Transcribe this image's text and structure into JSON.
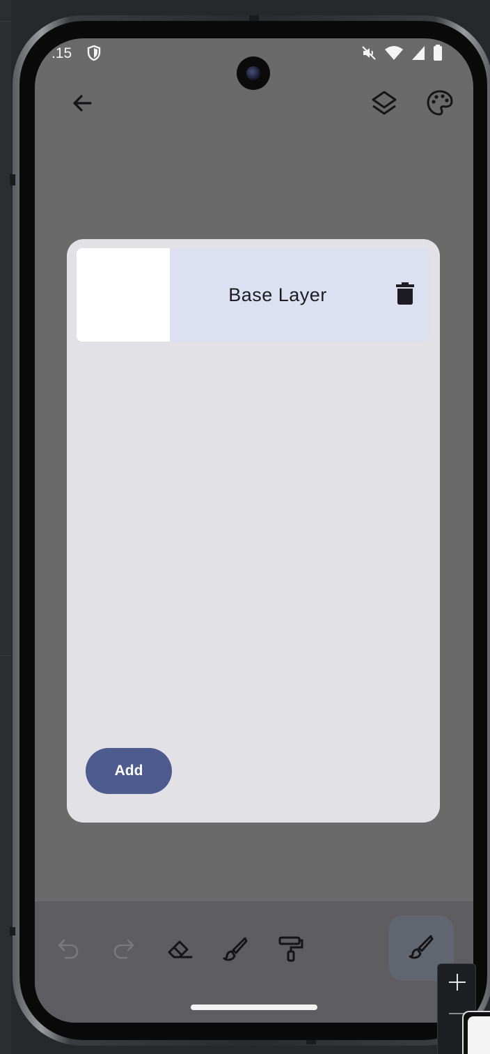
{
  "status_bar": {
    "time": ".15",
    "icons": [
      "shield-icon",
      "mute-icon",
      "wifi-icon",
      "signal-icon",
      "battery-icon"
    ]
  },
  "app_bar": {
    "back_icon": "arrow-back-icon",
    "layers_icon": "layers-icon",
    "palette_icon": "palette-icon"
  },
  "layers_dialog": {
    "layers": [
      {
        "name": "Base Layer",
        "selected": true
      }
    ],
    "add_label": "Add"
  },
  "toolbar": {
    "tools": [
      "undo-icon",
      "redo-icon",
      "eraser-icon",
      "brush-icon",
      "paint-roller-icon"
    ],
    "active_tool": "brush-icon"
  },
  "colors": {
    "screen_scrim": "#6a6a6b",
    "dialog_bg": "#e2e1e6",
    "layer_selected_bg": "#dce0f1",
    "add_button_bg": "#4e5b8f",
    "toolbar_bg": "#5e5e62"
  }
}
